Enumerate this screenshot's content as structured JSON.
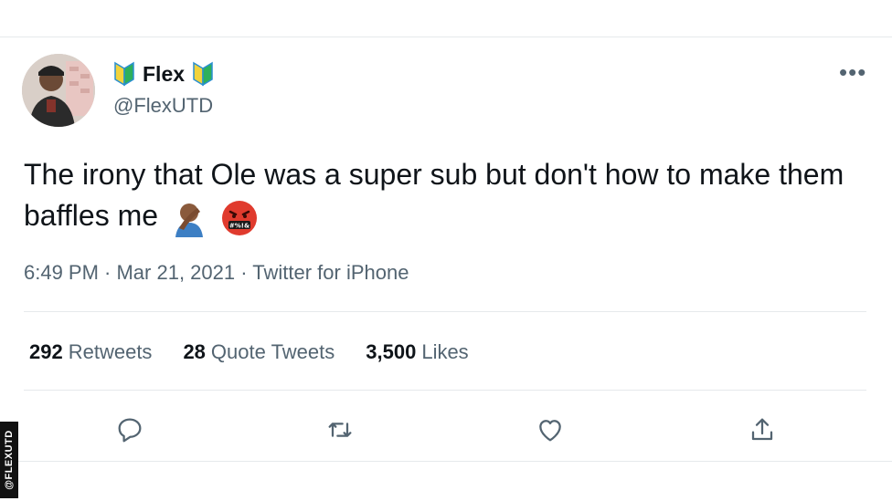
{
  "tweet": {
    "display_name": "Flex",
    "handle": "@FlexUTD",
    "more_label": "•••",
    "text": "The irony that Ole was a super sub but don't how to make them baffles me",
    "emojis": [
      "facepalm-emoji",
      "cursing-face-emoji"
    ],
    "timestamp": "6:49 PM · Mar 21, 2021 · Twitter for iPhone",
    "stats": {
      "retweets_count": "292",
      "retweets_label": "Retweets",
      "quotes_count": "28",
      "quotes_label": "Quote Tweets",
      "likes_count": "3,500",
      "likes_label": "Likes"
    }
  },
  "actions": [
    "reply-icon",
    "retweet-icon",
    "like-icon",
    "share-icon"
  ],
  "watermark": "@FLEXUTD",
  "colors": {
    "text_primary": "#0f1419",
    "text_secondary": "#536471",
    "border": "#e6e9ec",
    "badge_yellow": "#f2d33b",
    "badge_green": "#2db05b"
  }
}
